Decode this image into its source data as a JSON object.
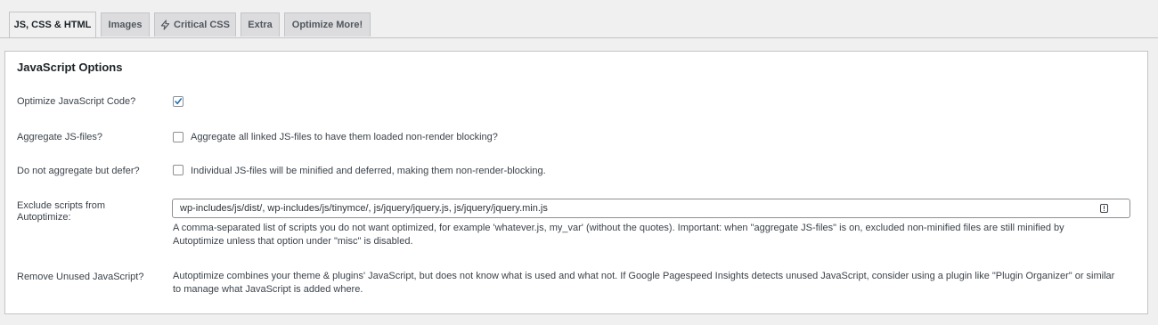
{
  "tabs": [
    {
      "label": "JS, CSS & HTML",
      "active": true
    },
    {
      "label": "Images"
    },
    {
      "label": "Critical CSS",
      "icon": "lightning-bolt-icon"
    },
    {
      "label": "Extra"
    },
    {
      "label": "Optimize More!"
    }
  ],
  "panel": {
    "title": "JavaScript Options",
    "rows": {
      "optimize_js": {
        "label": "Optimize JavaScript Code?",
        "checked": true
      },
      "aggregate_js": {
        "label": "Aggregate JS-files?",
        "checkbox_label": "Aggregate all linked JS-files to have them loaded non-render blocking?",
        "checked": false
      },
      "defer_js": {
        "label": "Do not aggregate but defer?",
        "checkbox_label": "Individual JS-files will be minified and deferred, making them non-render-blocking.",
        "checked": false
      },
      "exclude": {
        "label_line1": "Exclude scripts from",
        "label_line2": "Autoptimize:",
        "value": "wp-includes/js/dist/, wp-includes/js/tinymce/, js/jquery/jquery.js, js/jquery/jquery.min.js",
        "icon": "alert-icon",
        "desc_line1": "A comma-separated list of scripts you do not want optimized, for example 'whatever.js, my_var' (without the quotes). Important: when \"aggregate JS-files\" is on, excluded non-minified files are still minified by",
        "desc_line2": "Autoptimize unless that option under \"misc\" is disabled."
      },
      "unused_js": {
        "label": "Remove Unused JavaScript?",
        "desc_line1": "Autoptimize combines your theme & plugins' JavaScript, but does not know what is used and what not. If Google Pagespeed Insights detects unused JavaScript, consider using a plugin like \"Plugin Organizer\" or similar",
        "desc_line2": "to manage what JavaScript is added where."
      }
    }
  },
  "colors": {
    "accent": "#2271b1",
    "tab_bg": "#dcdcde",
    "border": "#c3c4c7"
  }
}
